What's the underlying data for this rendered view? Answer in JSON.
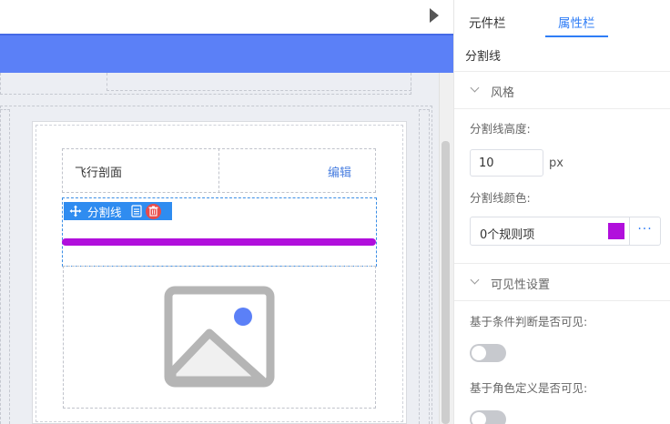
{
  "canvas": {
    "divider_toolbar_label": "分割线",
    "title_cell_text": "飞行剖面",
    "edit_link": "编辑",
    "divider_color": "#b10fdc",
    "accent_blue": "#5b80f7"
  },
  "panel": {
    "tabs": [
      {
        "label": "元件栏",
        "active": false
      },
      {
        "label": "属性栏",
        "active": true
      }
    ],
    "component_name": "分割线",
    "sections": {
      "style": {
        "title": "风格",
        "divider_height_label": "分割线高度:",
        "divider_height_value": "10",
        "divider_height_unit": "px",
        "divider_color_label": "分割线颜色:",
        "rule_text": "0个规则项",
        "swatch_color": "#b10fdc",
        "more_label": "···"
      },
      "visibility": {
        "title": "可见性设置",
        "conditional_label": "基于条件判断是否可见:",
        "conditional_enabled": false,
        "role_label": "基于角色定义是否可见:",
        "role_enabled": false
      }
    }
  }
}
